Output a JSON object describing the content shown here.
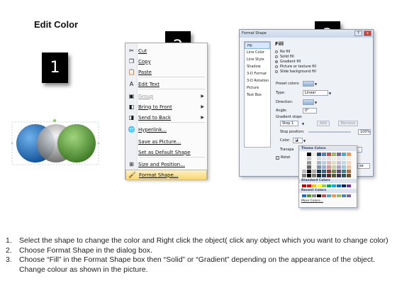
{
  "title": "Edit Color",
  "badges": [
    "1",
    "2",
    "3"
  ],
  "colors": {
    "circle_blue": "#1f6fc0",
    "circle_grey": "#8a8a8a",
    "circle_green": "#4f9a2a",
    "menu_highlight": "#f9d76c",
    "badge_bg": "#000000"
  },
  "context_menu": {
    "items": [
      {
        "label": "Cut",
        "icon": "scissors-icon",
        "glyph": "✂",
        "enabled": true
      },
      {
        "label": "Copy",
        "icon": "copy-icon",
        "glyph": "❐",
        "enabled": true
      },
      {
        "label": "Paste",
        "icon": "paste-icon",
        "glyph": "📋",
        "enabled": true
      },
      {
        "label": "Edit Text",
        "icon": "edit-text-icon",
        "glyph": "A",
        "enabled": true
      },
      {
        "label": "Group",
        "icon": "group-icon",
        "glyph": "▣",
        "enabled": false,
        "submenu": true
      },
      {
        "label": "Bring to Front",
        "icon": "bring-front-icon",
        "glyph": "◧",
        "enabled": true,
        "submenu": true
      },
      {
        "label": "Send to Back",
        "icon": "send-back-icon",
        "glyph": "◨",
        "enabled": true,
        "submenu": true
      },
      {
        "label": "Hyperlink...",
        "icon": "hyperlink-icon",
        "glyph": "🌐",
        "enabled": true
      },
      {
        "label": "Save as Picture...",
        "icon": "",
        "glyph": "",
        "enabled": true
      },
      {
        "label": "Set as Default Shape",
        "icon": "",
        "glyph": "",
        "enabled": true
      },
      {
        "label": "Size and Position...",
        "icon": "size-position-icon",
        "glyph": "⊞",
        "enabled": true
      },
      {
        "label": "Format Shape...",
        "icon": "format-shape-icon",
        "glyph": "🖌",
        "enabled": true,
        "highlighted": true
      }
    ]
  },
  "dialog": {
    "title": "Format Shape",
    "close_label": "x",
    "nav": [
      "Fill",
      "Line Color",
      "Line Style",
      "Shadow",
      "3-D Format",
      "3-D Rotation",
      "Picture",
      "Text Box"
    ],
    "selected_nav": "Fill",
    "section": "Fill",
    "fill_options": [
      {
        "label": "No fill",
        "checked": false
      },
      {
        "label": "Solid fill",
        "checked": false
      },
      {
        "label": "Gradient fill",
        "checked": true
      },
      {
        "label": "Picture or texture fill",
        "checked": false
      },
      {
        "label": "Slide background fill",
        "checked": false
      }
    ],
    "preset_label": "Preset colors:",
    "type_label": "Type:",
    "type_value": "Linear",
    "direction_label": "Direction:",
    "angle_label": "Angle:",
    "angle_value": "0°",
    "gradient_stops_label": "Gradient stops",
    "stop_value": "Stop 1",
    "add_label": "Add",
    "remove_label": "Remove",
    "stop_position_label": "Stop position:",
    "stop_position_value": "100%",
    "color_label": "Color:",
    "transparency_label": "Transpa",
    "transparency_value": "%",
    "rotate_label": "Rotat",
    "close_button": "se"
  },
  "palette": {
    "theme_label": "Theme Colors",
    "standard_label": "Standard Colors",
    "recent_label": "Recent Colors",
    "more_label": "More Colors...",
    "theme_top": [
      "#ffffff",
      "#000000",
      "#eeece1",
      "#1f497d",
      "#4f81bd",
      "#c0504d",
      "#9bbb59",
      "#8064a2",
      "#4bacc6",
      "#f79646"
    ],
    "standard": [
      "#c00000",
      "#ff0000",
      "#ffc000",
      "#ffff00",
      "#92d050",
      "#00b050",
      "#00b0f0",
      "#0070c0",
      "#002060",
      "#7030a0"
    ],
    "recent": [
      "#1f6fc0",
      "#4f9a2a",
      "#8a8a8a",
      "#000000",
      "#c0504d",
      "#4bacc6",
      "#f79646",
      "#9bbb59",
      "#4f81bd",
      "#8064a2"
    ]
  },
  "instructions": [
    {
      "num": "1.",
      "text": "Select the shape to change the color and Right click the object( click any object which you want to change color)"
    },
    {
      "num": "2.",
      "text": "Choose Format Shape in the dialog box."
    },
    {
      "num": "3.",
      "text": "Choose “Fill” in the Format Shape box then “Solid” or “Gradient” depending on the appearance of the object. Change colour as shown in the picture."
    }
  ]
}
